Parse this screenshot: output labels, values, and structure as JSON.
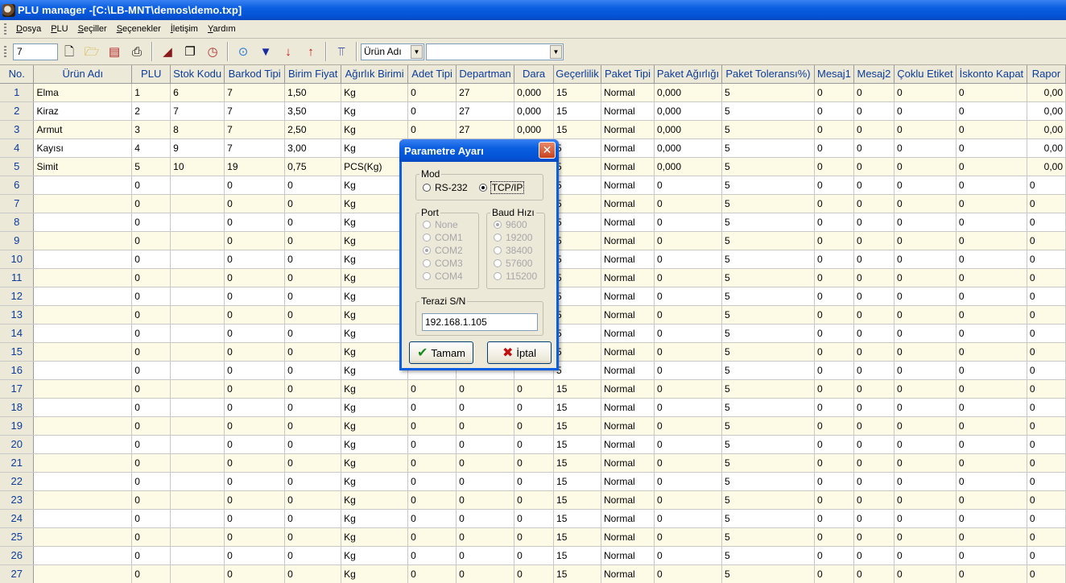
{
  "window": {
    "title": "PLU manager -[C:\\LB-MNT\\demos\\demo.txp]"
  },
  "menu": [
    {
      "label": "Dosya",
      "key": "D"
    },
    {
      "label": "PLU",
      "key": "P"
    },
    {
      "label": "Seçiller",
      "key": "S"
    },
    {
      "label": "Seçenekler",
      "key": "S"
    },
    {
      "label": "İletişim",
      "key": "İ"
    },
    {
      "label": "Yardım",
      "key": "Y"
    }
  ],
  "toolbar": {
    "plu_input": "7",
    "search_field": "Ürün Adı",
    "search_value": ""
  },
  "table": {
    "headers": [
      "No.",
      "Ürün Adı",
      "PLU",
      "Stok Kodu",
      "Barkod Tipi",
      "Birim Fiyat",
      "Ağırlık Birimi",
      "Adet Tipi",
      "Departman",
      "Dara",
      "Geçerlilik",
      "Paket Tipi",
      "Paket Ağırlığı",
      "Paket Toleransı%)",
      "Mesaj1",
      "Mesaj2",
      "Çoklu Etiket",
      "İskonto Kapat",
      "Rapor"
    ],
    "rows": [
      [
        "1",
        "Elma",
        "1",
        "6",
        "7",
        "1,50",
        "Kg",
        "0",
        "27",
        "0,000",
        "15",
        "Normal",
        "0,000",
        "5",
        "0",
        "0",
        "0",
        "0",
        "0,00"
      ],
      [
        "2",
        "Kiraz",
        "2",
        "7",
        "7",
        "3,50",
        "Kg",
        "0",
        "27",
        "0,000",
        "15",
        "Normal",
        "0,000",
        "5",
        "0",
        "0",
        "0",
        "0",
        "0,00"
      ],
      [
        "3",
        "Armut",
        "3",
        "8",
        "7",
        "2,50",
        "Kg",
        "0",
        "27",
        "0,000",
        "15",
        "Normal",
        "0,000",
        "5",
        "0",
        "0",
        "0",
        "0",
        "0,00"
      ],
      [
        "4",
        "Kayısı",
        "4",
        "9",
        "7",
        "3,00",
        "Kg",
        "",
        "",
        "",
        "5",
        "Normal",
        "0,000",
        "5",
        "0",
        "0",
        "0",
        "0",
        "0,00"
      ],
      [
        "5",
        "Simit",
        "5",
        "10",
        "19",
        "0,75",
        "PCS(Kg)",
        "",
        "",
        "",
        "5",
        "Normal",
        "0,000",
        "5",
        "0",
        "0",
        "0",
        "0",
        "0,00"
      ],
      [
        "6",
        "",
        "0",
        "",
        "0",
        "0",
        "Kg",
        "",
        "",
        "",
        "5",
        "Normal",
        "0",
        "5",
        "0",
        "0",
        "0",
        "0",
        "0"
      ],
      [
        "7",
        "",
        "0",
        "",
        "0",
        "0",
        "Kg",
        "",
        "",
        "",
        "5",
        "Normal",
        "0",
        "5",
        "0",
        "0",
        "0",
        "0",
        "0"
      ],
      [
        "8",
        "",
        "0",
        "",
        "0",
        "0",
        "Kg",
        "",
        "",
        "",
        "5",
        "Normal",
        "0",
        "5",
        "0",
        "0",
        "0",
        "0",
        "0"
      ],
      [
        "9",
        "",
        "0",
        "",
        "0",
        "0",
        "Kg",
        "",
        "",
        "",
        "5",
        "Normal",
        "0",
        "5",
        "0",
        "0",
        "0",
        "0",
        "0"
      ],
      [
        "10",
        "",
        "0",
        "",
        "0",
        "0",
        "Kg",
        "",
        "",
        "",
        "5",
        "Normal",
        "0",
        "5",
        "0",
        "0",
        "0",
        "0",
        "0"
      ],
      [
        "11",
        "",
        "0",
        "",
        "0",
        "0",
        "Kg",
        "",
        "",
        "",
        "5",
        "Normal",
        "0",
        "5",
        "0",
        "0",
        "0",
        "0",
        "0"
      ],
      [
        "12",
        "",
        "0",
        "",
        "0",
        "0",
        "Kg",
        "",
        "",
        "",
        "5",
        "Normal",
        "0",
        "5",
        "0",
        "0",
        "0",
        "0",
        "0"
      ],
      [
        "13",
        "",
        "0",
        "",
        "0",
        "0",
        "Kg",
        "",
        "",
        "",
        "5",
        "Normal",
        "0",
        "5",
        "0",
        "0",
        "0",
        "0",
        "0"
      ],
      [
        "14",
        "",
        "0",
        "",
        "0",
        "0",
        "Kg",
        "",
        "",
        "",
        "5",
        "Normal",
        "0",
        "5",
        "0",
        "0",
        "0",
        "0",
        "0"
      ],
      [
        "15",
        "",
        "0",
        "",
        "0",
        "0",
        "Kg",
        "",
        "",
        "",
        "5",
        "Normal",
        "0",
        "5",
        "0",
        "0",
        "0",
        "0",
        "0"
      ],
      [
        "16",
        "",
        "0",
        "",
        "0",
        "0",
        "Kg",
        "",
        "",
        "",
        "5",
        "Normal",
        "0",
        "5",
        "0",
        "0",
        "0",
        "0",
        "0"
      ],
      [
        "17",
        "",
        "0",
        "",
        "0",
        "0",
        "Kg",
        "0",
        "0",
        "0",
        "15",
        "Normal",
        "0",
        "5",
        "0",
        "0",
        "0",
        "0",
        "0"
      ],
      [
        "18",
        "",
        "0",
        "",
        "0",
        "0",
        "Kg",
        "0",
        "0",
        "0",
        "15",
        "Normal",
        "0",
        "5",
        "0",
        "0",
        "0",
        "0",
        "0"
      ],
      [
        "19",
        "",
        "0",
        "",
        "0",
        "0",
        "Kg",
        "0",
        "0",
        "0",
        "15",
        "Normal",
        "0",
        "5",
        "0",
        "0",
        "0",
        "0",
        "0"
      ],
      [
        "20",
        "",
        "0",
        "",
        "0",
        "0",
        "Kg",
        "0",
        "0",
        "0",
        "15",
        "Normal",
        "0",
        "5",
        "0",
        "0",
        "0",
        "0",
        "0"
      ],
      [
        "21",
        "",
        "0",
        "",
        "0",
        "0",
        "Kg",
        "0",
        "0",
        "0",
        "15",
        "Normal",
        "0",
        "5",
        "0",
        "0",
        "0",
        "0",
        "0"
      ],
      [
        "22",
        "",
        "0",
        "",
        "0",
        "0",
        "Kg",
        "0",
        "0",
        "0",
        "15",
        "Normal",
        "0",
        "5",
        "0",
        "0",
        "0",
        "0",
        "0"
      ],
      [
        "23",
        "",
        "0",
        "",
        "0",
        "0",
        "Kg",
        "0",
        "0",
        "0",
        "15",
        "Normal",
        "0",
        "5",
        "0",
        "0",
        "0",
        "0",
        "0"
      ],
      [
        "24",
        "",
        "0",
        "",
        "0",
        "0",
        "Kg",
        "0",
        "0",
        "0",
        "15",
        "Normal",
        "0",
        "5",
        "0",
        "0",
        "0",
        "0",
        "0"
      ],
      [
        "25",
        "",
        "0",
        "",
        "0",
        "0",
        "Kg",
        "0",
        "0",
        "0",
        "15",
        "Normal",
        "0",
        "5",
        "0",
        "0",
        "0",
        "0",
        "0"
      ],
      [
        "26",
        "",
        "0",
        "",
        "0",
        "0",
        "Kg",
        "0",
        "0",
        "0",
        "15",
        "Normal",
        "0",
        "5",
        "0",
        "0",
        "0",
        "0",
        "0"
      ],
      [
        "27",
        "",
        "0",
        "",
        "0",
        "0",
        "Kg",
        "0",
        "0",
        "0",
        "15",
        "Normal",
        "0",
        "5",
        "0",
        "0",
        "0",
        "0",
        "0"
      ]
    ]
  },
  "dialog": {
    "title": "Parametre Ayarı",
    "mod": {
      "label": "Mod",
      "options": [
        {
          "label": "RS-232",
          "selected": false
        },
        {
          "label": "TCP/IP",
          "selected": true
        }
      ]
    },
    "port": {
      "label": "Port",
      "options": [
        {
          "label": "None",
          "selected": false
        },
        {
          "label": "COM1",
          "selected": false
        },
        {
          "label": "COM2",
          "selected": true
        },
        {
          "label": "COM3",
          "selected": false
        },
        {
          "label": "COM4",
          "selected": false
        }
      ]
    },
    "baud": {
      "label": "Baud Hızı",
      "options": [
        {
          "label": "9600",
          "selected": true
        },
        {
          "label": "19200",
          "selected": false
        },
        {
          "label": "38400",
          "selected": false
        },
        {
          "label": "57600",
          "selected": false
        },
        {
          "label": "115200",
          "selected": false
        }
      ]
    },
    "sn": {
      "label": "Terazi S/N",
      "value": "192.168.1.105"
    },
    "ok_label": "Tamam",
    "cancel_label": "İptal"
  },
  "colors": {
    "titlebar": "#0a5ee0",
    "header_text": "#0b3c9c",
    "row_alt": "#fdfbe6"
  }
}
